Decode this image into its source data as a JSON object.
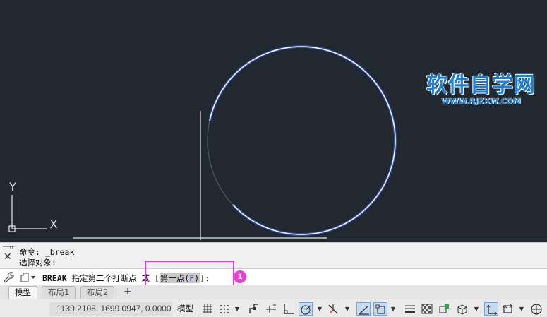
{
  "watermark": {
    "title": "软件自学网",
    "url": "WWW.RJZXW.COM"
  },
  "ucs": {
    "x_label": "X",
    "y_label": "Y"
  },
  "history": {
    "line1": "命令: _break",
    "line2": "选择对象:"
  },
  "command": {
    "name": "BREAK",
    "prompt": "指定第二个打断点 或 [",
    "option_label": "第一点(",
    "option_key": "F",
    "option_close": ")",
    "suffix": "]:"
  },
  "annotation": {
    "badge": "1",
    "color": "#e83fd8"
  },
  "tabs": [
    {
      "label": "模型",
      "active": true
    },
    {
      "label": "布局1",
      "active": false
    },
    {
      "label": "布局2",
      "active": false
    }
  ],
  "tab_add": "+",
  "status": {
    "coordinates": "1139.2105, 1699.0947, 0.0000",
    "model_label": "模型",
    "icons": [
      "grid-icon",
      "snap-icon",
      "infer-constraints-icon",
      "dynamic-input-icon",
      "ortho-icon",
      "polar-tracking-icon",
      "isodraft-icon",
      "object-snap-tracking-icon",
      "object-snap-icon",
      "lineweight-icon",
      "transparency-icon",
      "selection-cycling-icon",
      "3d-object-snap-icon",
      "ucs-icon",
      "annotation-monitor-icon",
      "workspace-icon"
    ]
  },
  "colors": {
    "canvas": "#212830",
    "circle": "#e8f0ff",
    "circle_glow": "#4a78ff",
    "highlight": "#e23be0"
  }
}
